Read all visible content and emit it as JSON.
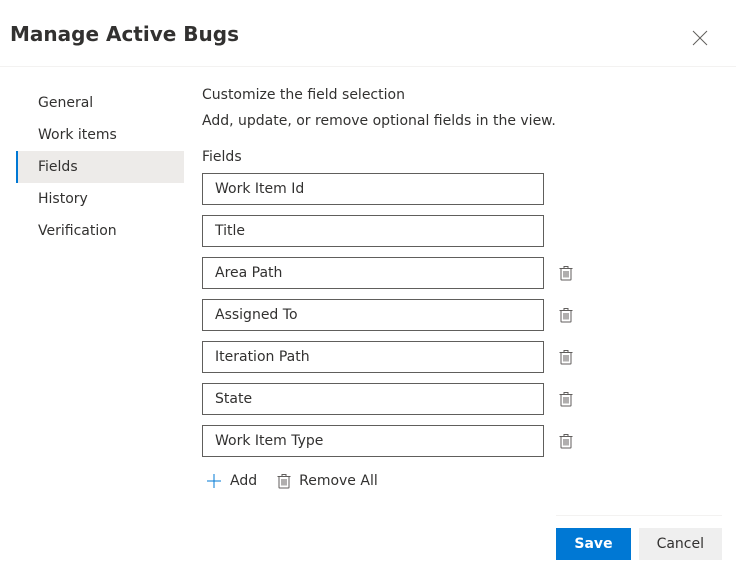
{
  "title": "Manage Active Bugs",
  "sidebar": {
    "items": [
      {
        "label": "General",
        "active": false
      },
      {
        "label": "Work items",
        "active": false
      },
      {
        "label": "Fields",
        "active": true
      },
      {
        "label": "History",
        "active": false
      },
      {
        "label": "Verification",
        "active": false
      }
    ]
  },
  "main": {
    "heading": "Customize the field selection",
    "sub": "Add, update, or remove optional fields in the view.",
    "fields_label": "Fields",
    "fields": [
      {
        "value": "Work Item Id",
        "removable": false
      },
      {
        "value": "Title",
        "removable": false
      },
      {
        "value": "Area Path",
        "removable": true
      },
      {
        "value": "Assigned To",
        "removable": true
      },
      {
        "value": "Iteration Path",
        "removable": true
      },
      {
        "value": "State",
        "removable": true
      },
      {
        "value": "Work Item Type",
        "removable": true
      }
    ],
    "add_label": "Add",
    "remove_all_label": "Remove All"
  },
  "footer": {
    "save": "Save",
    "cancel": "Cancel"
  }
}
